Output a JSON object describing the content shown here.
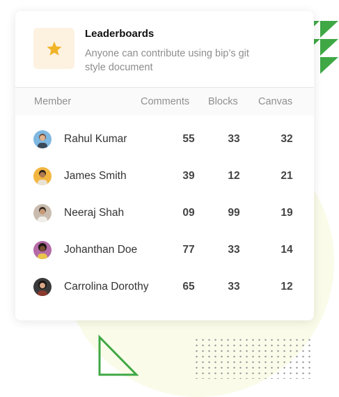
{
  "header": {
    "title": "Leaderboards",
    "subtitle": "Anyone can contribute using bip’s git style document",
    "icon": "star-icon"
  },
  "columns": [
    "Member",
    "Comments",
    "Blocks",
    "Canvas"
  ],
  "rows": [
    {
      "name": "Rahul Kumar",
      "comments": "55",
      "blocks": "33",
      "canvas": "32",
      "avatar_bg": "#7fb8e0"
    },
    {
      "name": "James Smith",
      "comments": "39",
      "blocks": "12",
      "canvas": "21",
      "avatar_bg": "#f2b641"
    },
    {
      "name": "Neeraj Shah",
      "comments": "09",
      "blocks": "99",
      "canvas": "19",
      "avatar_bg": "#c9bcae"
    },
    {
      "name": "Johanthan Doe",
      "comments": "77",
      "blocks": "33",
      "canvas": "14",
      "avatar_bg": "#b46aa7"
    },
    {
      "name": "Carrolina Dorothy",
      "comments": "65",
      "blocks": "33",
      "canvas": "12",
      "avatar_bg": "#3a3a3a"
    }
  ],
  "colors": {
    "accent_green": "#3fa845",
    "star": "#f0b429",
    "star_bg": "#fdf1e0"
  }
}
